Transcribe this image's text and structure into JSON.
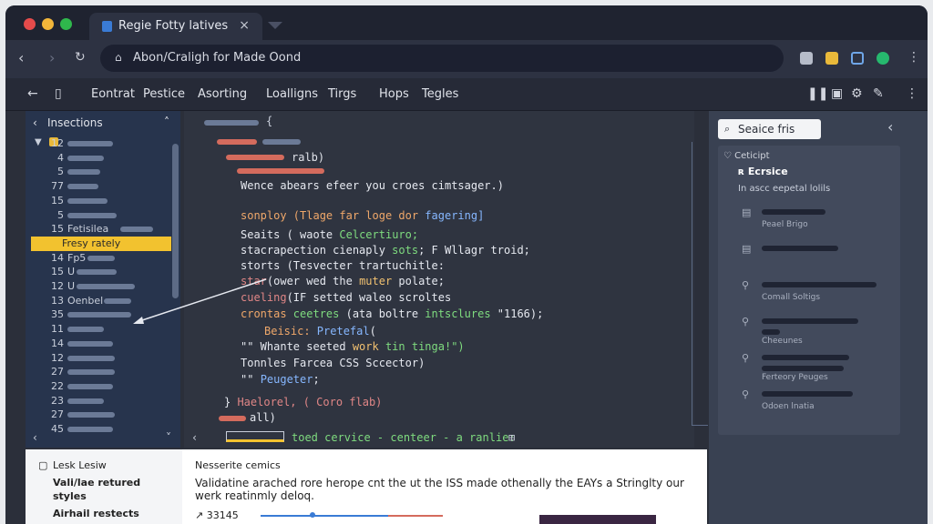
{
  "window": {
    "tab_title": "Regie Fotty latives",
    "tab_close": "×",
    "url": "Abon/Craligh for Made Oond",
    "lock_icon": "lock-icon"
  },
  "colors": {
    "close": "#e54b4b",
    "minimize": "#f2b63a",
    "zoom": "#2fb84c",
    "highlight": "#f2c22f",
    "accent": "#3a7bd5"
  },
  "menu": {
    "items": [
      "Eontrat",
      "Pestice",
      "Asorting",
      "Loalligns",
      "Tirgs",
      "Hops",
      "Tegles"
    ]
  },
  "sidebar": {
    "header": "Insections",
    "rows": [
      {
        "num": "12",
        "label": ""
      },
      {
        "num": "4",
        "label": ""
      },
      {
        "num": "5",
        "label": ""
      },
      {
        "num": "77",
        "label": ""
      },
      {
        "num": "15",
        "label": ""
      },
      {
        "num": "5",
        "label": ""
      },
      {
        "num": "15",
        "label": "Fetisilea"
      },
      {
        "num": "",
        "label": "Fresy rately"
      },
      {
        "num": "14",
        "label": "Fp5"
      },
      {
        "num": "15",
        "label": "U"
      },
      {
        "num": "12",
        "label": "U"
      },
      {
        "num": "13",
        "label": "Oenbel"
      },
      {
        "num": "35",
        "label": ""
      },
      {
        "num": "11",
        "label": ""
      },
      {
        "num": "14",
        "label": ""
      },
      {
        "num": "12",
        "label": ""
      },
      {
        "num": "27",
        "label": ""
      },
      {
        "num": "22",
        "label": ""
      },
      {
        "num": "23",
        "label": ""
      },
      {
        "num": "27",
        "label": ""
      },
      {
        "num": "45",
        "label": ""
      }
    ]
  },
  "code": {
    "line1": "{",
    "line2": "ralb)",
    "line3": "Wence abears efeer you croes cimtsager.)",
    "line4a": "sonploy (Tlage far loge dor ",
    "line4b": "fagering]",
    "line5a": "Seaits ( ",
    "line5b": "waote ",
    "line5c": "Celcertiuro;",
    "line6a": "stacrapection cienaply ",
    "line6b": "sots",
    "line6c": "; F Wllagr troid;",
    "line7": "storts (Tesvecter trartuchitle:",
    "line8a": "star",
    "line8b": "(ower wed the ",
    "line8c": "muter",
    "line8d": " polate;",
    "line9a": "cueling",
    "line9b": "(IF setted waleo scroltes",
    "line10a": "crontas ",
    "line10b": "ceetres",
    "line10c": " (ata boltre ",
    "line10d": "intsclures",
    "line10e": " \"1166);",
    "line11a": "Beisic: ",
    "line11b": "Pretefal",
    "line11c": "(",
    "line12a": "\"\" Whante seeted ",
    "line12b": "work",
    "line12c": " tin tinga!\")",
    "line13": "Tonnles Farcea CSS Sccector)",
    "line14a": "\"\" ",
    "line14b": "Peugeter",
    "line14c": ";",
    "line15a": "} ",
    "line15b": "Haelorel, ( Coro flab)",
    "line16": "all)",
    "status": "toed cervice - centeer - a ranlie:",
    "status_icon": "⊞"
  },
  "right": {
    "search_label": "Seaice fris",
    "collapse": "‹",
    "card_head": "Ceticipt",
    "card_title": "Ecrsice",
    "card_sub": "In ascc eepetal lolils",
    "items": [
      {
        "caption": "Peael Brigo"
      },
      {
        "caption": ""
      },
      {
        "caption": "Comall Soltigs"
      },
      {
        "caption": "Cheeunes"
      },
      {
        "caption": "Ferteory Peuges"
      },
      {
        "caption": "Odoen lnatia"
      }
    ]
  },
  "bottom": {
    "left_title": "Lesk Lesiw",
    "left_item1": "Vali/lae retured",
    "left_item1b": "styles",
    "left_item2": "Airhail restects",
    "main_title": "Nesserite cemics",
    "main_body1": "Validatine arached rore herope cnt the ut the ISS made othenally the EAYs a Stringlty our",
    "main_body2": "werk reatinmly deloq.",
    "main_value": "↗ 33145"
  }
}
